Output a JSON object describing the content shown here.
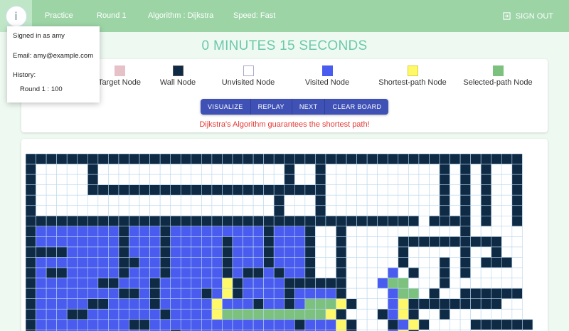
{
  "nav": {
    "logo_glyph": "i",
    "practice": "Practice",
    "round": "Round 1",
    "algorithm": "Algorithm : Dijkstra",
    "speed": "Speed: Fast",
    "signout": "SIGN OUT"
  },
  "timer": "0 MINUTES 15 SECONDS",
  "legend": [
    {
      "label": "Target Node",
      "color": "#e6c1c8"
    },
    {
      "label": "Wall Node",
      "color": "#0f2a45"
    },
    {
      "label": "Unvisited Node",
      "color": "#ffffff"
    },
    {
      "label": "Visited Node",
      "color": "#4a5bef"
    },
    {
      "label": "Shortest-path Node",
      "color": "#fff96a"
    },
    {
      "label": "Selected-path Node",
      "color": "#7cc17e"
    }
  ],
  "buttons": [
    "VISUALIZE",
    "REPLAY",
    "NEXT",
    "CLEAR BOARD"
  ],
  "message": "Dijkstra's Algorithm guarantees the shortest path!",
  "user_menu": {
    "signed_in": "Signed in as amy",
    "email": "Email: amy@example.com",
    "history_label": "History:",
    "history_item": "Round 1 : 100"
  },
  "colors": {
    "wall": "#0f2a45",
    "visited": "#4a5bef",
    "shortest": "#fff96a",
    "selected": "#7cc17e",
    "unvisited": "#ffffff",
    "gridline": "#b9d7ee"
  },
  "grid": {
    "rows": [
      "################################################",
      "#.....#..................#..#...........#.#.#..#",
      "#.....#..................#..#...........#.#.#..#",
      "#.....#######################...........#.#.#..#",
      "#.......................#...#...........#.#.#..#",
      "#.......................#...#...........#.#.#..#",
      "######################################.####.#..#",
      "#VVVVVVVV#VVV#VVVVVVVVV#VVV#..#...........#.....",
      "#VVVVVVVV#VVV#VVVVV#VVV#VVV#..#.....##########..",
      "####VVVVV#VVV#VVVVV#VVV#VVV#..#.....#.....#..#..",
      "#VVVVVVVV##VV#VVVVV#VVV#VVV#..#.....#...#.#.###.",
      "#V##VVVVV#VVV#VVVVV#V##V#VV#..#....V.#..#.#.....",
      "#VVVVVV##VVV#VVVVVVY#VVVV######...VGS...#.......",
      "#VVVVVVVV##V#VVVV#VY#VVVV#VVVV#....VGS.#..######",
      "#VVVVV##VVVV#VVVVVYVVV#VV#VGGSY#...VY#########..",
      "#VVV##VVVVVVV#VVVVYGGGGGGGGGSY#...#VY#..#.......",
      "#VVVVVVVVV##VVVVVVVVVVVVVV#VVVY#...#VY#....######",
      "#VVVVVVVVVVVVV#VVVVVVVVVVVVVVVY#...VY#.........."
    ]
  }
}
